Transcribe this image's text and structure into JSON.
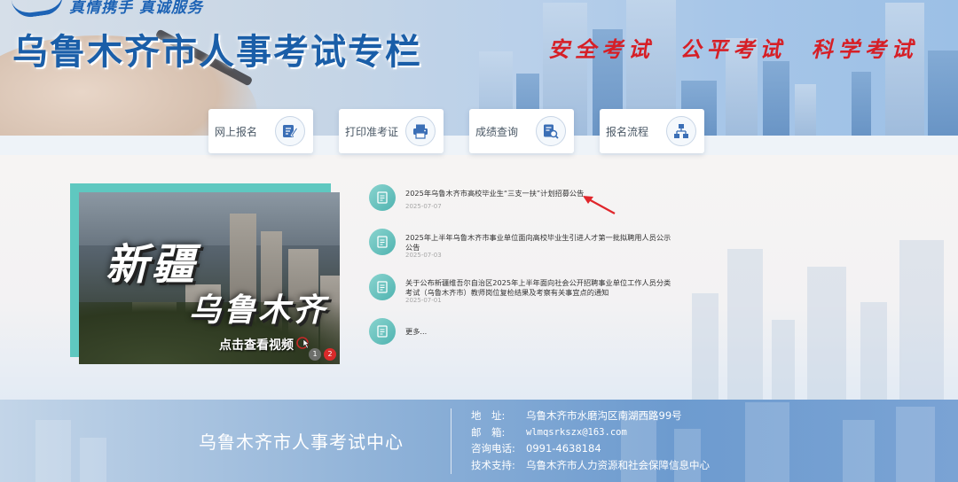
{
  "header": {
    "slogan": "真情携手 真诚服务",
    "title": "乌鲁木齐市人事考试专栏",
    "motto": [
      "安全考试",
      "公平考试",
      "科学考试"
    ]
  },
  "nav": [
    {
      "label": "网上报名",
      "icon": "edit-icon"
    },
    {
      "label": "打印准考证",
      "icon": "printer-icon"
    },
    {
      "label": "成绩查询",
      "icon": "search-document-icon"
    },
    {
      "label": "报名流程",
      "icon": "flowchart-icon"
    }
  ],
  "video": {
    "line1": "新疆",
    "line2": "乌鲁木齐",
    "play_hint": "点击查看视频",
    "slides": [
      "1",
      "2"
    ],
    "active_slide": 2
  },
  "news": [
    {
      "title": "2025年乌鲁木齐市高校毕业生“三支一扶”计划招募公告",
      "date": "2025-07-07"
    },
    {
      "title": "2025年上半年乌鲁木齐市事业单位面向高校毕业生引进人才第一批拟聘用人员公示公告",
      "date": "2025-07-03"
    },
    {
      "title": "关于公布新疆维吾尔自治区2025年上半年面向社会公开招聘事业单位工作人员分类考试（乌鲁木齐市）教师岗位复检结果及考察有关事宜点的通知",
      "date": "2025-07-01"
    },
    {
      "title": "更多...",
      "date": ""
    }
  ],
  "footer": {
    "org": "乌鲁木齐市人事考试中心",
    "address_label": "地　址:",
    "address": "乌鲁木齐市水磨沟区南湖西路99号",
    "email_label": "邮　箱:",
    "email": "wlmqsrkszx@163.com",
    "phone_label": "咨询电话:",
    "phone": "0991-4638184",
    "support_label": "技术支持:",
    "support": "乌鲁木齐市人力资源和社会保障信息中心"
  },
  "colors": {
    "title_blue": "#1a5ea8",
    "motto_red": "#d61f26",
    "teal_accent": "#5fc8c0",
    "annotation_red": "#e0262b"
  }
}
